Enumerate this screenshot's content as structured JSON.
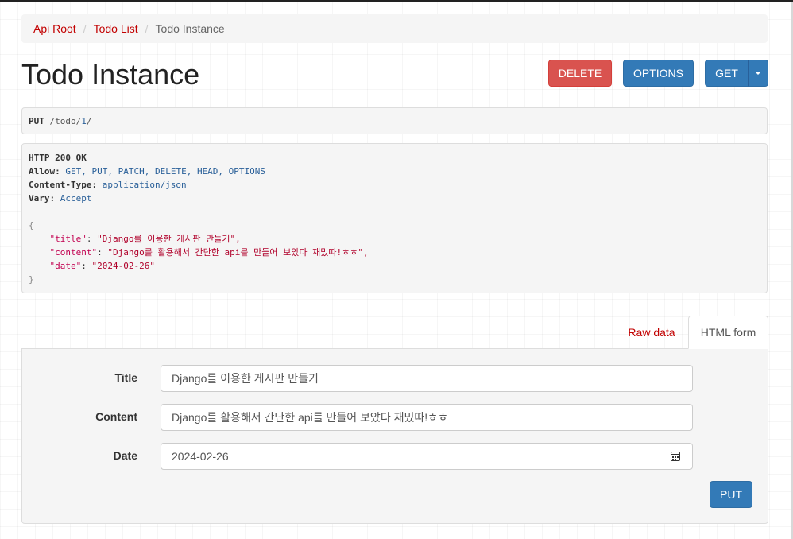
{
  "breadcrumb": {
    "items": [
      {
        "label": "Api Root"
      },
      {
        "label": "Todo List"
      }
    ],
    "active": "Todo Instance",
    "separator": "/"
  },
  "page": {
    "title": "Todo Instance"
  },
  "toolbar": {
    "delete_label": "DELETE",
    "options_label": "OPTIONS",
    "get_label": "GET"
  },
  "request": {
    "method": "PUT",
    "path_prefix": "/todo/",
    "path_id": "1",
    "path_suffix": "/"
  },
  "response": {
    "status_line": "HTTP 200 OK",
    "headers": [
      {
        "key": "Allow:",
        "value": "GET, PUT, PATCH, DELETE, HEAD, OPTIONS"
      },
      {
        "key": "Content-Type:",
        "value": "application/json"
      },
      {
        "key": "Vary:",
        "value": "Accept"
      }
    ],
    "body": {
      "open": "{",
      "close": "}",
      "fields": [
        {
          "key": "\"title\"",
          "value": "\"Django를 이용한 게시판 만들기\","
        },
        {
          "key": "\"content\"",
          "value": "\"Django를 활용해서 간단한 api를 만들어 보았다 재밌따!ㅎㅎ\","
        },
        {
          "key": "\"date\"",
          "value": "\"2024-02-26\""
        }
      ]
    }
  },
  "tabs": {
    "raw_label": "Raw data",
    "html_label": "HTML form",
    "active": "HTML form"
  },
  "form": {
    "fields": [
      {
        "label": "Title",
        "value": "Django를 이용한 게시판 만들기"
      },
      {
        "label": "Content",
        "value": "Django를 활용해서 간단한 api를 만들어 보았다 재밌따!ㅎㅎ"
      },
      {
        "label": "Date",
        "value": "2024-02-26"
      }
    ],
    "submit_label": "PUT"
  },
  "colors": {
    "link": "#c20000",
    "primary": "#337ab7",
    "danger": "#d9534f",
    "panel_bg": "#f5f5f5"
  },
  "icons": {
    "caret": "chevron-down-icon",
    "date": "calendar-icon"
  }
}
